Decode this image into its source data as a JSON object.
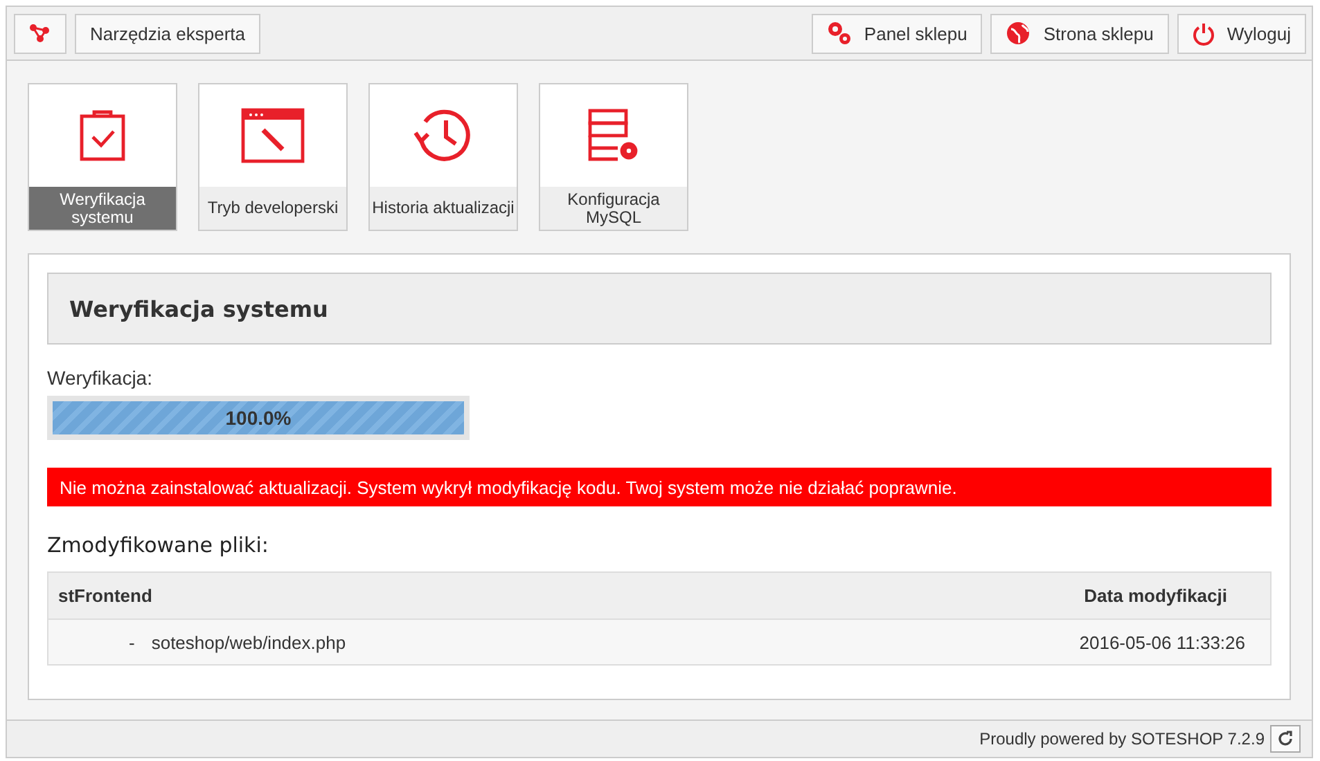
{
  "toolbar": {
    "title": "Narzędzia eksperta",
    "buttons": [
      {
        "label": "Panel sklepu"
      },
      {
        "label": "Strona sklepu"
      },
      {
        "label": "Wyloguj"
      }
    ]
  },
  "tiles": [
    {
      "label": "Weryfikacja systemu",
      "selected": true
    },
    {
      "label": "Tryb developerski",
      "selected": false
    },
    {
      "label": "Historia aktualizacji",
      "selected": false
    },
    {
      "label": "Konfiguracja MySQL",
      "selected": false
    }
  ],
  "panel": {
    "title": "Weryfikacja systemu",
    "progress_label": "Weryfikacja:",
    "progress": {
      "level": 1.0,
      "reading": "100.0%"
    },
    "alert": "Nie można zainstalować aktualizacji. System wykrył modyfikację kodu. Twoj system może nie działać poprawnie.",
    "files_title": "Zmodyfikowane pliki:",
    "table": {
      "columns": [
        "stFrontend",
        "Data modyfikacji"
      ],
      "rows": [
        {
          "marker": "-",
          "path": "soteshop/web/index.php",
          "date": "2016-05-06 11:33:26"
        }
      ]
    }
  },
  "footer": {
    "text": "Proudly powered by SOTESHOP 7.2.9"
  }
}
